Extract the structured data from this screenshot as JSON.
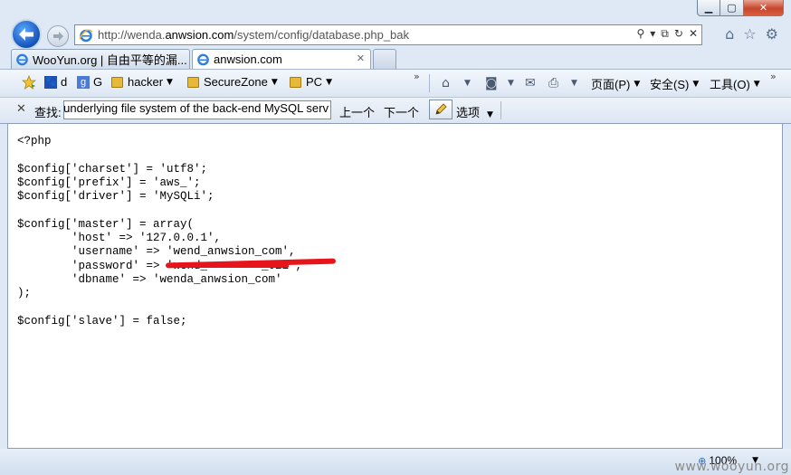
{
  "window": {
    "minimize_glyph": "▁",
    "maximize_glyph": "▢",
    "close_glyph": "✕"
  },
  "nav": {
    "address_prefix": "http://wenda.",
    "address_domain": "anwsion.com",
    "address_suffix": "/system/config/database.php_bak",
    "address_tools": [
      "search-icon",
      "dropdown-icon",
      "compat-icon",
      "refresh-icon",
      "stop-icon"
    ],
    "right_icons": [
      "home-icon",
      "star-icon",
      "gear-icon"
    ]
  },
  "tabs": [
    {
      "label": "WooYun.org | 自由平等的漏...",
      "active": false
    },
    {
      "label": "anwsion.com",
      "active": true
    }
  ],
  "favorites": {
    "items": [
      {
        "label": "d"
      },
      {
        "label": "G"
      },
      {
        "label": "hacker"
      },
      {
        "label": "SecureZone"
      },
      {
        "label": "PC"
      }
    ]
  },
  "commands": {
    "page": "页面(P)",
    "safety": "安全(S)",
    "tools": "工具(O)"
  },
  "find": {
    "label": "查找:",
    "value": "underlying file system of the back-end MySQL serv",
    "prev": "上一个",
    "next": "下一个",
    "options": "选项"
  },
  "content": {
    "lines": [
      "<?php",
      "",
      "$config['charset'] = 'utf8';",
      "$config['prefix'] = 'aws_';",
      "$config['driver'] = 'MySQLi';",
      "",
      "$config['master'] = array(",
      "        'host' => '127.0.0.1',",
      "        'username' => 'wend_anwsion_com',",
      "        'password' => 'wend_        _021',",
      "        'dbname' => 'wenda_anwsion_com'",
      ");",
      "",
      "$config['slave'] = false;"
    ]
  },
  "status": {
    "zoom": "100%",
    "watermark": "www.wooyun.org"
  },
  "colors": {
    "redaction": "#e8141c",
    "ie_blue": "#1553b8"
  }
}
